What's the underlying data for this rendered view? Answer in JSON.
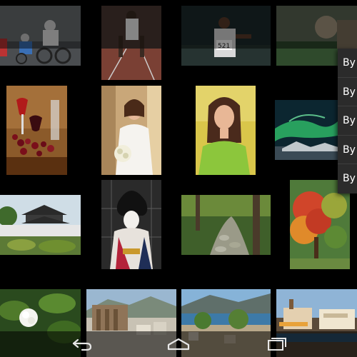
{
  "overflow_menu": {
    "items": [
      {
        "label": "By"
      },
      {
        "label": "By"
      },
      {
        "label": "By"
      },
      {
        "label": "By"
      },
      {
        "label": "By"
      }
    ]
  },
  "photos": [
    {
      "subject": "cyclists-racing"
    },
    {
      "subject": "sprinter-in-blocks"
    },
    {
      "subject": "runner-with-bib"
    },
    {
      "subject": "partial-outdoor-scene"
    },
    {
      "subject": "wine-and-grapes"
    },
    {
      "subject": "bride-with-bouquet"
    },
    {
      "subject": "smiling-woman-green-dress"
    },
    {
      "subject": "aurora-over-water"
    },
    {
      "subject": "japanese-temple"
    },
    {
      "subject": "geisha-portrait"
    },
    {
      "subject": "stone-forest-path"
    },
    {
      "subject": "autumn-tree"
    },
    {
      "subject": "white-flower"
    },
    {
      "subject": "ancient-ruins-city"
    },
    {
      "subject": "harbor-town"
    },
    {
      "subject": "waterfront-buildings"
    }
  ],
  "navigation": {
    "back": "back-icon",
    "home": "home-icon",
    "recents": "recent-apps-icon"
  },
  "colors": {
    "background": "#000000",
    "menu_background": "#2b2b2b",
    "menu_text": "#ffffff"
  }
}
